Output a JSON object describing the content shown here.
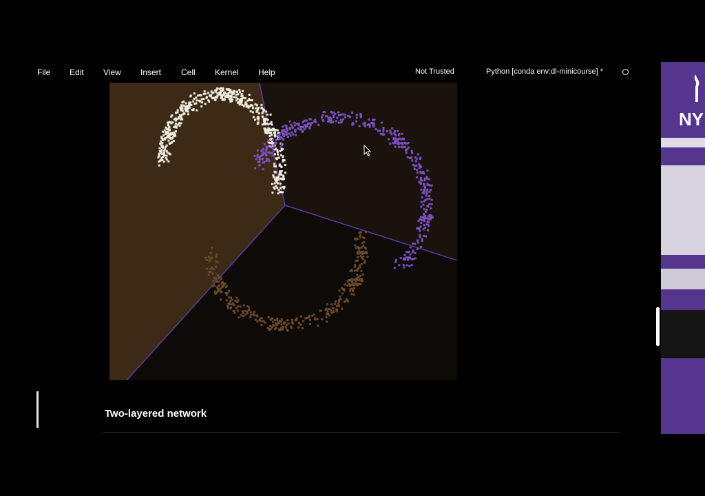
{
  "menu": {
    "items": [
      {
        "label": "File"
      },
      {
        "label": "Edit"
      },
      {
        "label": "View"
      },
      {
        "label": "Insert"
      },
      {
        "label": "Cell"
      },
      {
        "label": "Kernel"
      },
      {
        "label": "Help"
      }
    ]
  },
  "notebook": {
    "trust_status": "Not Trusted",
    "kernel_name": "Python [conda env:dl-minicourse] *"
  },
  "cells": {
    "markdown_heading": "Two-layered network"
  },
  "side_panel": {
    "logo_text": "NY",
    "icon": "torch-icon"
  },
  "chart_data": {
    "type": "scatter",
    "description_classes": 3,
    "series": [
      {
        "color": "#f0ece0"
      },
      {
        "color": "#7a4fc0"
      },
      {
        "color": "#6b4a2c"
      }
    ],
    "region_colors": [
      "#3d2a16",
      "#1a120c",
      "#0d0a08"
    ],
    "grid": false
  },
  "colors": {
    "background": "#000000",
    "accent": "#56358e"
  }
}
